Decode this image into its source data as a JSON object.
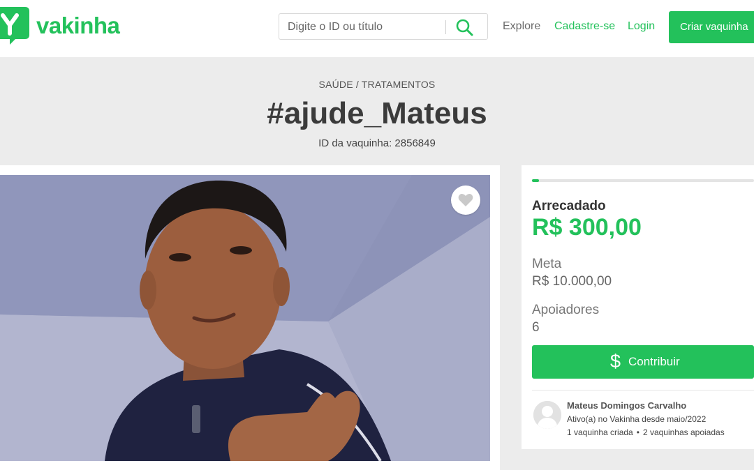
{
  "header": {
    "brand": "vakinha",
    "search_placeholder": "Digite o ID ou título",
    "nav": {
      "explore": "Explore",
      "signup": "Cadastre-se",
      "login": "Login",
      "create": "Criar vaquinha"
    }
  },
  "campaign": {
    "category": "SAÚDE / TRATAMENTOS",
    "title": "#ajude_Mateus",
    "id_text": "ID da vaquinha: 2856849"
  },
  "stats": {
    "progress_fraction": 0.03,
    "raised_label": "Arrecadado",
    "raised_value": "R$ 300,00",
    "goal_label": "Meta",
    "goal_value": "R$ 10.000,00",
    "supporters_label": "Apoiadores",
    "supporters_value": "6",
    "contribute_label": "Contribuir"
  },
  "owner": {
    "name": "Mateus Domingos Carvalho",
    "since": "Ativo(a) no Vakinha desde maio/2022",
    "created": "1 vaquinha criada",
    "supported": "2 vaquinhas apoiadas"
  },
  "colors": {
    "brand_green": "#23c15b",
    "background": "#ececec"
  },
  "icons": [
    "vakinha-logo-icon",
    "search-icon",
    "heart-icon",
    "dollar-icon",
    "user-avatar-icon"
  ]
}
